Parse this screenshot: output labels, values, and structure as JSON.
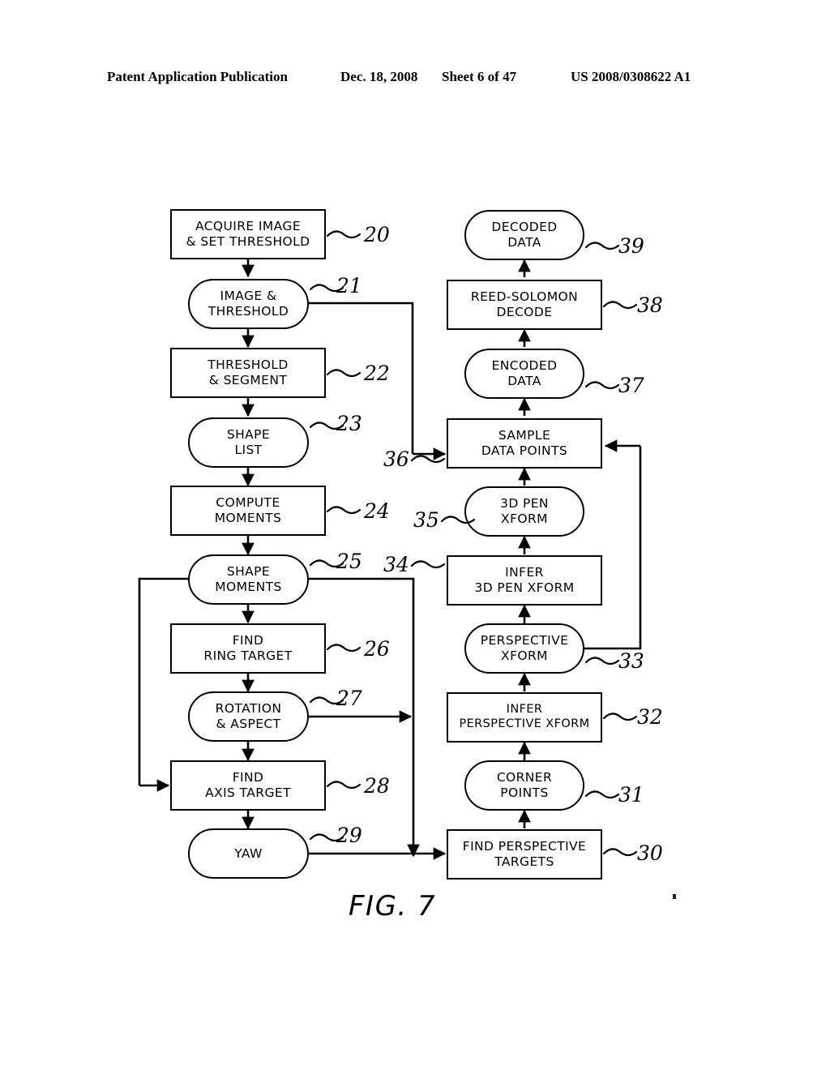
{
  "header": {
    "publication": "Patent Application Publication",
    "date": "Dec. 18, 2008",
    "sheet": "Sheet 6 of 47",
    "patent_number": "US 2008/0308622 A1"
  },
  "figure": {
    "caption": "FIG. 7",
    "nodes": [
      {
        "id": "n20",
        "ref": "20",
        "shape": "rect",
        "label": "ACQUIRE IMAGE\n& SET THRESHOLD"
      },
      {
        "id": "n21",
        "ref": "21",
        "shape": "round",
        "label": "IMAGE &\nTHRESHOLD"
      },
      {
        "id": "n22",
        "ref": "22",
        "shape": "rect",
        "label": "THRESHOLD\n& SEGMENT"
      },
      {
        "id": "n23",
        "ref": "23",
        "shape": "round",
        "label": "SHAPE\nLIST"
      },
      {
        "id": "n24",
        "ref": "24",
        "shape": "rect",
        "label": "COMPUTE\nMOMENTS"
      },
      {
        "id": "n25",
        "ref": "25",
        "shape": "round",
        "label": "SHAPE\nMOMENTS"
      },
      {
        "id": "n26",
        "ref": "26",
        "shape": "rect",
        "label": "FIND\nRING TARGET"
      },
      {
        "id": "n27",
        "ref": "27",
        "shape": "round",
        "label": "ROTATION\n& ASPECT"
      },
      {
        "id": "n28",
        "ref": "28",
        "shape": "rect",
        "label": "FIND\nAXIS TARGET"
      },
      {
        "id": "n29",
        "ref": "29",
        "shape": "round",
        "label": "YAW"
      },
      {
        "id": "n30",
        "ref": "30",
        "shape": "rect",
        "label": "FIND PERSPECTIVE\nTARGETS"
      },
      {
        "id": "n31",
        "ref": "31",
        "shape": "round",
        "label": "CORNER\nPOINTS"
      },
      {
        "id": "n32",
        "ref": "32",
        "shape": "rect",
        "label": "INFER\nPERSPECTIVE XFORM"
      },
      {
        "id": "n33",
        "ref": "33",
        "shape": "round",
        "label": "PERSPECTIVE\nXFORM"
      },
      {
        "id": "n34",
        "ref": "34",
        "shape": "rect",
        "label": "INFER\n3D PEN XFORM"
      },
      {
        "id": "n35",
        "ref": "35",
        "shape": "round",
        "label": "3D PEN\nXFORM"
      },
      {
        "id": "n36",
        "ref": "36",
        "shape": "rect",
        "label": "SAMPLE\nDATA POINTS"
      },
      {
        "id": "n37",
        "ref": "37",
        "shape": "round",
        "label": "ENCODED\nDATA"
      },
      {
        "id": "n38",
        "ref": "38",
        "shape": "rect",
        "label": "REED-SOLOMON\nDECODE"
      },
      {
        "id": "n39",
        "ref": "39",
        "shape": "round",
        "label": "DECODED\nDATA"
      }
    ]
  }
}
